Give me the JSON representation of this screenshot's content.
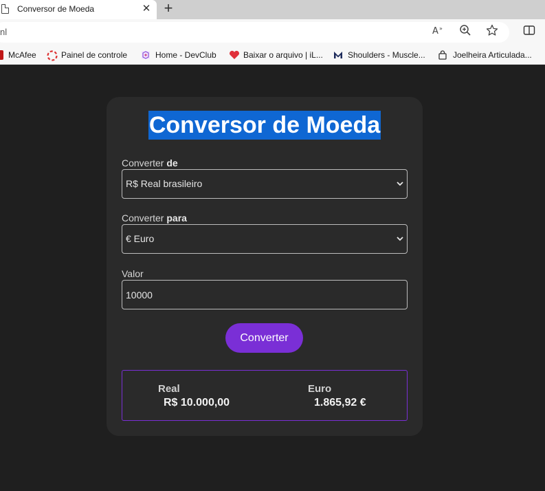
{
  "browser": {
    "tab_title": "Conversor de Moeda",
    "address_text": "nl",
    "bookmarks": [
      {
        "label": "McAfee",
        "icon": "mcafee-icon",
        "color": "#c01818"
      },
      {
        "label": "Painel de controle",
        "icon": "lifebuoy-icon",
        "color": "#d33"
      },
      {
        "label": "Home - DevClub",
        "icon": "devclub-icon",
        "color": "#8a4fd6"
      },
      {
        "label": "Baixar o arquivo | iL...",
        "icon": "heart-icon",
        "color": "#e0303a"
      },
      {
        "label": "Shoulders - Muscle...",
        "icon": "m-logo-icon",
        "color": "#1c2a5a"
      },
      {
        "label": "Joelheira Articulada...",
        "icon": "bag-icon",
        "color": "#333333"
      }
    ]
  },
  "converter": {
    "title": "Conversor de Moeda",
    "from_label_prefix": "Converter ",
    "from_label_bold": "de",
    "from_value": "R$ Real brasileiro",
    "to_label_prefix": "Converter ",
    "to_label_bold": "para",
    "to_value": "€ Euro",
    "amount_label": "Valor",
    "amount_value": "10000",
    "button_label": "Converter",
    "result": {
      "from_currency": "Real",
      "from_amount": "R$ 10.000,00",
      "to_currency": "Euro",
      "to_amount": "1.865,92 €"
    }
  },
  "colors": {
    "accent": "#7a2fd6",
    "title_highlight": "#0f67d3",
    "page_bg": "#1f1f1f",
    "card_bg": "#2a2a2a"
  }
}
